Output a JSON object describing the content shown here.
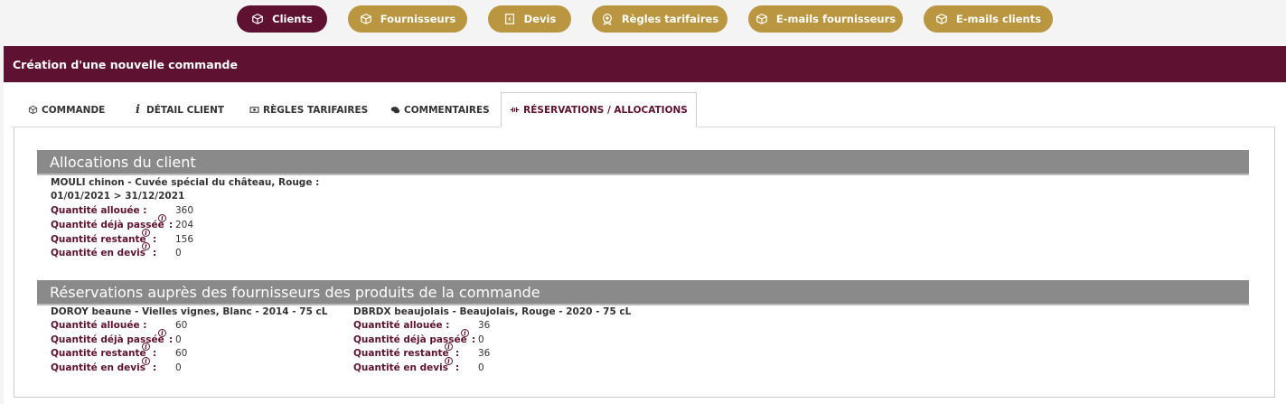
{
  "nav": {
    "items": [
      {
        "label": "Clients",
        "icon": "box-icon",
        "active": true
      },
      {
        "label": "Fournisseurs",
        "icon": "box-icon",
        "active": false
      },
      {
        "label": "Devis",
        "icon": "document-icon",
        "active": false
      },
      {
        "label": "Règles tarifaires",
        "icon": "badge-icon",
        "active": false
      },
      {
        "label": "E-mails fournisseurs",
        "icon": "box-icon",
        "active": false
      },
      {
        "label": "E-mails clients",
        "icon": "box-icon",
        "active": false
      }
    ]
  },
  "header": {
    "title": "Création d'une nouvelle commande"
  },
  "tabs": [
    {
      "label": "COMMANDE",
      "icon": "box-icon"
    },
    {
      "label": "DÉTAIL CLIENT",
      "icon": "info-icon"
    },
    {
      "label": "RÈGLES TARIFAIRES",
      "icon": "money-icon"
    },
    {
      "label": "COMMENTAIRES",
      "icon": "comments-icon"
    },
    {
      "label": "RÉSERVATIONS / ALLOCATIONS",
      "icon": "allocations-icon",
      "active": true
    }
  ],
  "allocations": {
    "title": "Allocations du client",
    "product": "MOULI chinon - Cuvée spécial du château, Rouge :",
    "period": "01/01/2021 > 31/12/2021",
    "rows": [
      {
        "label": "Quantité allouée :",
        "value": "360"
      },
      {
        "label": "Quantité déjà passée",
        "suffix": ":",
        "value": "204"
      },
      {
        "label": "Quantité restante",
        "suffix": ":",
        "value": "156"
      },
      {
        "label": "Quantité en devis",
        "suffix": ":",
        "value": "0"
      }
    ]
  },
  "reservations": {
    "title": "Réservations auprès des fournisseurs des produits de la commande",
    "products": [
      {
        "name": "DOROY beaune - Vielles vignes, Blanc - 2014 - 75 cL",
        "rows": [
          {
            "label": "Quantité allouée :",
            "value": "60"
          },
          {
            "label": "Quantité déjà passée",
            "suffix": ":",
            "value": "0"
          },
          {
            "label": "Quantité restante",
            "suffix": ":",
            "value": "60"
          },
          {
            "label": "Quantité en devis",
            "suffix": ":",
            "value": "0"
          }
        ]
      },
      {
        "name": "DBRDX beaujolais - Beaujolais, Rouge - 2020 - 75 cL",
        "rows": [
          {
            "label": "Quantité allouée :",
            "value": "36"
          },
          {
            "label": "Quantité déjà passée",
            "suffix": ":",
            "value": "0"
          },
          {
            "label": "Quantité restante",
            "suffix": ":",
            "value": "36"
          },
          {
            "label": "Quantité en devis",
            "suffix": ":",
            "value": "0"
          }
        ]
      }
    ]
  },
  "colors": {
    "primary": "#5e1130",
    "accent": "#b9963f",
    "section": "#8a8a8b"
  }
}
